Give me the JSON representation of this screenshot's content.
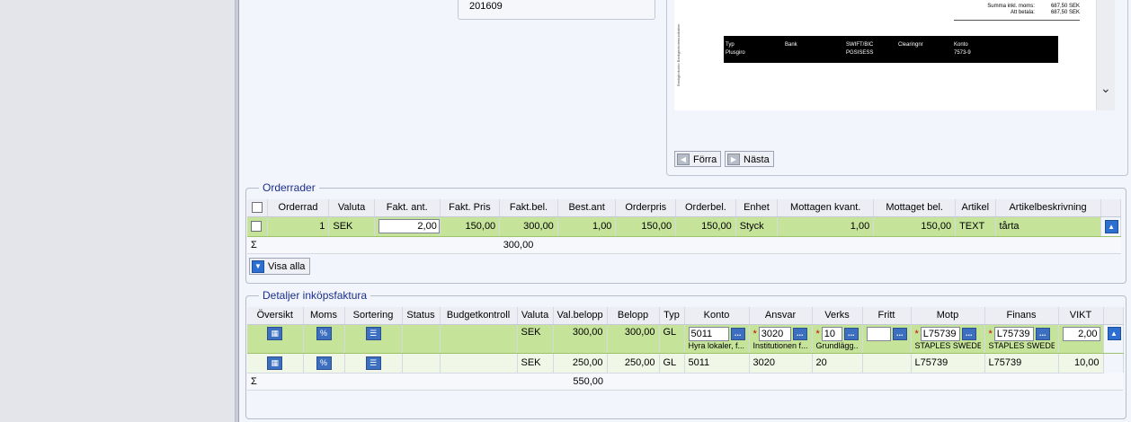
{
  "top": {
    "period_value": "201609",
    "invoice_preview": {
      "side_text": "Bankgirokonto Bankgirokommunikation",
      "totals": [
        {
          "label": "Summa inkl. moms:",
          "value": "687,50 SEK"
        },
        {
          "label": "Att betala:",
          "value": "687,50 SEK"
        }
      ],
      "bank_headers": [
        "Typ",
        "Bank",
        "SWIFT/BIC",
        "Clearingnr",
        "Konto"
      ],
      "bank_values": [
        "Plusgiro",
        "",
        "PGSISESS",
        "",
        "7573-9"
      ]
    },
    "nav": {
      "prev": "Förra",
      "next": "Nästa"
    }
  },
  "orderrader": {
    "legend": "Orderrader",
    "columns": [
      "Orderrad",
      "Valuta",
      "Fakt. ant.",
      "Fakt. Pris",
      "Fakt.bel.",
      "Best.ant",
      "Orderpris",
      "Orderbel.",
      "Enhet",
      "Mottagen kvant.",
      "Mottaget bel.",
      "Artikel",
      "Artikelbeskrivning"
    ],
    "row": {
      "orderrad": "1",
      "valuta": "SEK",
      "fakt_ant": "2,00",
      "fakt_pris": "150,00",
      "fakt_bel": "300,00",
      "best_ant": "1,00",
      "orderpris": "150,00",
      "orderbel": "150,00",
      "enhet": "Styck",
      "mottagen_kvant": "1,00",
      "mottaget_bel": "150,00",
      "artikel": "TEXT",
      "artikelbeskrivning": "tårta"
    },
    "sum_symbol": "Σ",
    "sum_value": "300,00",
    "show_all": "Visa alla"
  },
  "detaljer": {
    "legend": "Detaljer inköpsfaktura",
    "columns": [
      "Översikt",
      "Moms",
      "Sortering",
      "Status",
      "Budgetkontroll",
      "Valuta",
      "Val.belopp",
      "Belopp",
      "Typ",
      "Konto",
      "Ansvar",
      "Verks",
      "Fritt",
      "Motp",
      "Finans",
      "VIKT"
    ],
    "row1": {
      "valuta": "SEK",
      "val_belopp": "300,00",
      "belopp": "300,00",
      "typ": "GL",
      "konto": "5011",
      "konto_desc": "Hyra lokaler, f...",
      "ansvar": "3020",
      "ansvar_desc": "Institutionen f...",
      "verks": "10",
      "verks_desc": "Grundlägg...",
      "fritt": "",
      "motp": "L75739",
      "motp_desc": "STAPLES SWEDE...",
      "finans": "L75739",
      "finans_desc": "STAPLES SWEDE...",
      "vikt": "2,00"
    },
    "row2": {
      "valuta": "SEK",
      "val_belopp": "250,00",
      "belopp": "250,00",
      "typ": "GL",
      "konto": "5011",
      "ansvar": "3020",
      "verks": "20",
      "fritt": "",
      "motp": "L75739",
      "finans": "L75739",
      "vikt": "10,00"
    },
    "sum_symbol": "Σ",
    "sum_value": "550,00"
  }
}
